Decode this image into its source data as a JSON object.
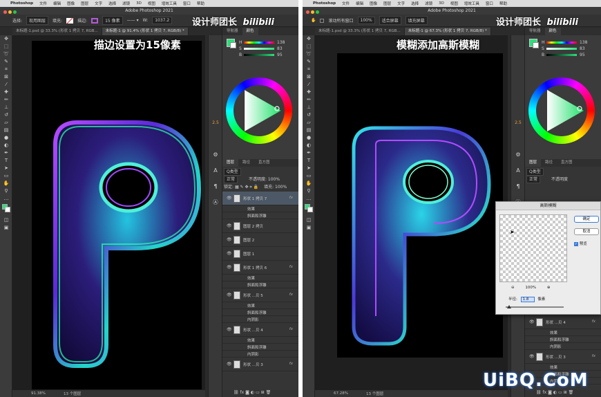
{
  "menu": {
    "app": "Photoshop",
    "items": [
      "文件",
      "编辑",
      "图像",
      "图层",
      "文字",
      "选择",
      "滤镜",
      "3D",
      "视图",
      "增效工具",
      "窗口",
      "帮助"
    ]
  },
  "window_title": "Adobe Photoshop 2021",
  "watermark": {
    "text": "设计师团长",
    "logo": "bilibili"
  },
  "left": {
    "options": {
      "select_label": "选择:",
      "select_value": "现用图层",
      "fill_label": "填充:",
      "stroke_label": "描边:",
      "stroke_width": "15 像素",
      "w_label": "W:",
      "w_value": "1037.2"
    },
    "tabs": [
      "未标题-1.psd @ 33.3% (形状 1 拷贝 7, RGB...",
      "未标题-1 @ 91.4% (形状 1 拷贝 7, RGB/8) *"
    ],
    "caption": "描边设置为15像素",
    "status": {
      "zoom": "91.38%",
      "layers": "13 个图层"
    },
    "color_panel_tabs": [
      "导航器",
      "颜色"
    ],
    "hsb": [
      {
        "label": "H",
        "value": "138"
      },
      {
        "label": "S",
        "value": "83"
      },
      {
        "label": "B",
        "value": "95"
      }
    ],
    "layers_tabs": [
      "图层",
      "路径",
      "直方图"
    ],
    "layer_kind": "Q类型",
    "blend_mode": "正常",
    "opacity_label": "不透明度:",
    "opacity_value": "100%",
    "lock_label": "锁定:",
    "fill_label": "填充:",
    "fill_value": "100%",
    "layers": [
      {
        "name": "形状 1 拷贝 7",
        "fx": "fx",
        "selected": true
      },
      {
        "name": "效果",
        "sub": true
      },
      {
        "name": "斜面和浮雕",
        "sub": true
      },
      {
        "name": "图层 2 拷贝"
      },
      {
        "name": "图层 2"
      },
      {
        "name": "图层 1"
      },
      {
        "name": "形状 1 拷贝 6",
        "fx": "fx"
      },
      {
        "name": "效果",
        "sub": true
      },
      {
        "name": "斜面和浮雕",
        "sub": true
      },
      {
        "name": "形状 ...贝 5",
        "fx": "fx"
      },
      {
        "name": "效果",
        "sub": true
      },
      {
        "name": "斜面和浮雕",
        "sub": true
      },
      {
        "name": "内阴影",
        "sub": true
      },
      {
        "name": "形状 ...贝 4",
        "fx": "fx"
      },
      {
        "name": "效果",
        "sub": true
      },
      {
        "name": "斜面和浮雕",
        "sub": true
      },
      {
        "name": "内阴影",
        "sub": true
      },
      {
        "name": "形状 ...贝 3",
        "fx": "fx"
      }
    ],
    "ribbon_label": "2.5"
  },
  "right": {
    "options": {
      "auto_scroll": "滚动所有窗口",
      "zoom": "100%",
      "fit": "适合屏幕",
      "fill": "填充屏幕"
    },
    "tabs": [
      "未标题-1.psd @ 33.3% (形状 1 拷贝 7, RGB...",
      "未标题-1 @ 67.3% (形状 1 拷贝 7, RGB/8) *"
    ],
    "caption": "模糊添加高斯模糊",
    "status": {
      "zoom": "67.28%",
      "layers": "13 个图层"
    },
    "dialog": {
      "title": "高斯模糊",
      "ok": "确定",
      "cancel": "取消",
      "preview_label": "预览",
      "zoom": "100%",
      "radius_label": "半径:",
      "radius_value": "1.8",
      "radius_unit": "像素"
    },
    "layers_tabs": [
      "图层",
      "路径",
      "直方图"
    ],
    "layer_kind": "Q类型",
    "blend_mode": "正常",
    "opacity_label": "不透明度",
    "layers": [
      {
        "name": "形状 ...贝 4",
        "fx": "fx"
      },
      {
        "name": "效果",
        "sub": true
      },
      {
        "name": "斜面和浮雕",
        "sub": true
      },
      {
        "name": "内阴影",
        "sub": true
      },
      {
        "name": "形状 ...贝 3",
        "fx": "fx"
      },
      {
        "name": "效果",
        "sub": true
      },
      {
        "name": "斜面和浮雕",
        "sub": true
      },
      {
        "name": "内阴影",
        "sub": true
      }
    ],
    "ribbon_label": "2.5"
  },
  "footer_logo": "UiBQ.CoM"
}
